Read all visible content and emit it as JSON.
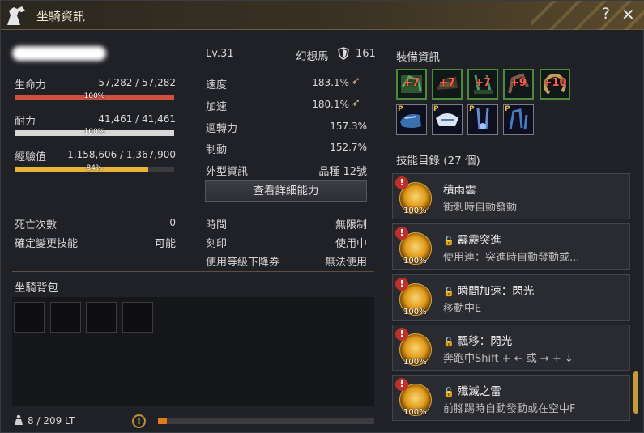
{
  "window": {
    "title": "坐騎資訊",
    "help_glyph": "?",
    "close_glyph": "✕"
  },
  "mount": {
    "level": "Lv.31",
    "type": "幻想馬",
    "defense_value": "161"
  },
  "stats": {
    "hp": {
      "label": "生命力",
      "value": "57,282 / 57,282",
      "pct_label": "100%",
      "pct": 100
    },
    "stamina": {
      "label": "耐力",
      "value": "41,461 / 41,461",
      "pct_label": "100%",
      "pct": 100
    },
    "exp": {
      "label": "經驗值",
      "value": "1,158,606 / 1,367,900",
      "pct_label": "84%",
      "pct": 84
    }
  },
  "attributes": [
    {
      "label": "速度",
      "value": "183.1%",
      "icon": "wing-icon"
    },
    {
      "label": "加速",
      "value": "180.1%",
      "icon": "wing-icon"
    },
    {
      "label": "迴轉力",
      "value": "157.3%"
    },
    {
      "label": "制動",
      "value": "152.7%"
    },
    {
      "label": "外型資訊",
      "value": "品種 12號"
    }
  ],
  "details_button": "查看詳細能力",
  "misc_left": [
    {
      "label": "死亡次數",
      "value": "0"
    },
    {
      "label": "確定變更技能",
      "value": "可能"
    }
  ],
  "misc_right": [
    {
      "label": "時間",
      "value": "無限制"
    },
    {
      "label": "刻印",
      "value": "使用中"
    },
    {
      "label": "使用等級下降券",
      "value": "無法使用"
    }
  ],
  "bag": {
    "title": "坐騎背包",
    "weight": "8 / 209 LT",
    "alert_glyph": "!"
  },
  "equipment": {
    "title": "裝備資訊",
    "enhanced": [
      "+7",
      "+7",
      "+7",
      "+9",
      "+10"
    ],
    "p_items": [
      "P",
      "P",
      "P",
      "P"
    ]
  },
  "skills": {
    "title": "技能目錄 (27 個)",
    "items": [
      {
        "name": "積雨雲",
        "desc": "衝刺時自動發動",
        "pct": "100%",
        "locked": false
      },
      {
        "name": "霹靂突進",
        "desc": "使用連：突進時自動發動或...",
        "pct": "100%",
        "locked": true
      },
      {
        "name": "瞬間加速：閃光",
        "desc": "移動中E",
        "pct": "100%",
        "locked": true
      },
      {
        "name": "飄移：閃光",
        "desc": "奔跑中Shift + ← 或 → + ↓",
        "pct": "100%",
        "locked": true
      },
      {
        "name": "殲滅之雷",
        "desc": "前腳踢時自動發動或在空中F",
        "pct": "100%",
        "locked": true
      }
    ],
    "warn_glyph": "!"
  },
  "colors": {
    "hp": "#d0503e",
    "stamina": "#d7d7d7",
    "exp": "#e9b33a",
    "accent": "#c99a3a"
  }
}
